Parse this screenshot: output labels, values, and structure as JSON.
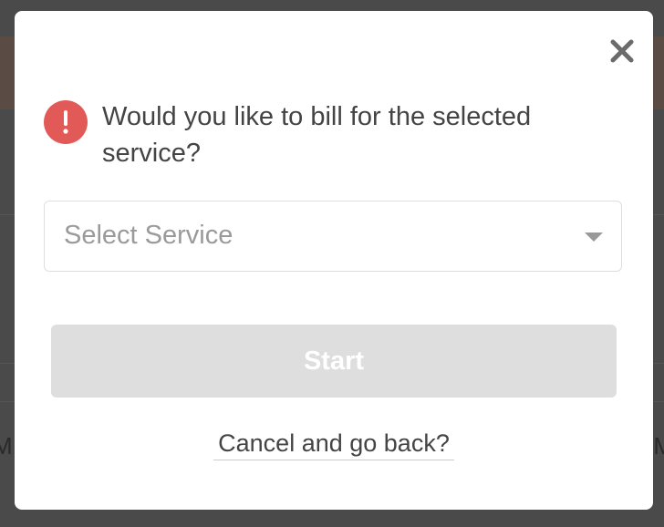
{
  "background": {
    "left_fragment": "M",
    "right_fragment": "M"
  },
  "modal": {
    "close_icon": "close-icon",
    "alert_icon": "exclamation-icon",
    "alert_color": "#e15a57",
    "question": "Would you like to bill for the selected service?",
    "service_select": {
      "placeholder": "Select Service",
      "value": ""
    },
    "start_label": "Start",
    "start_disabled": true,
    "cancel_label": "Cancel and go back?"
  }
}
